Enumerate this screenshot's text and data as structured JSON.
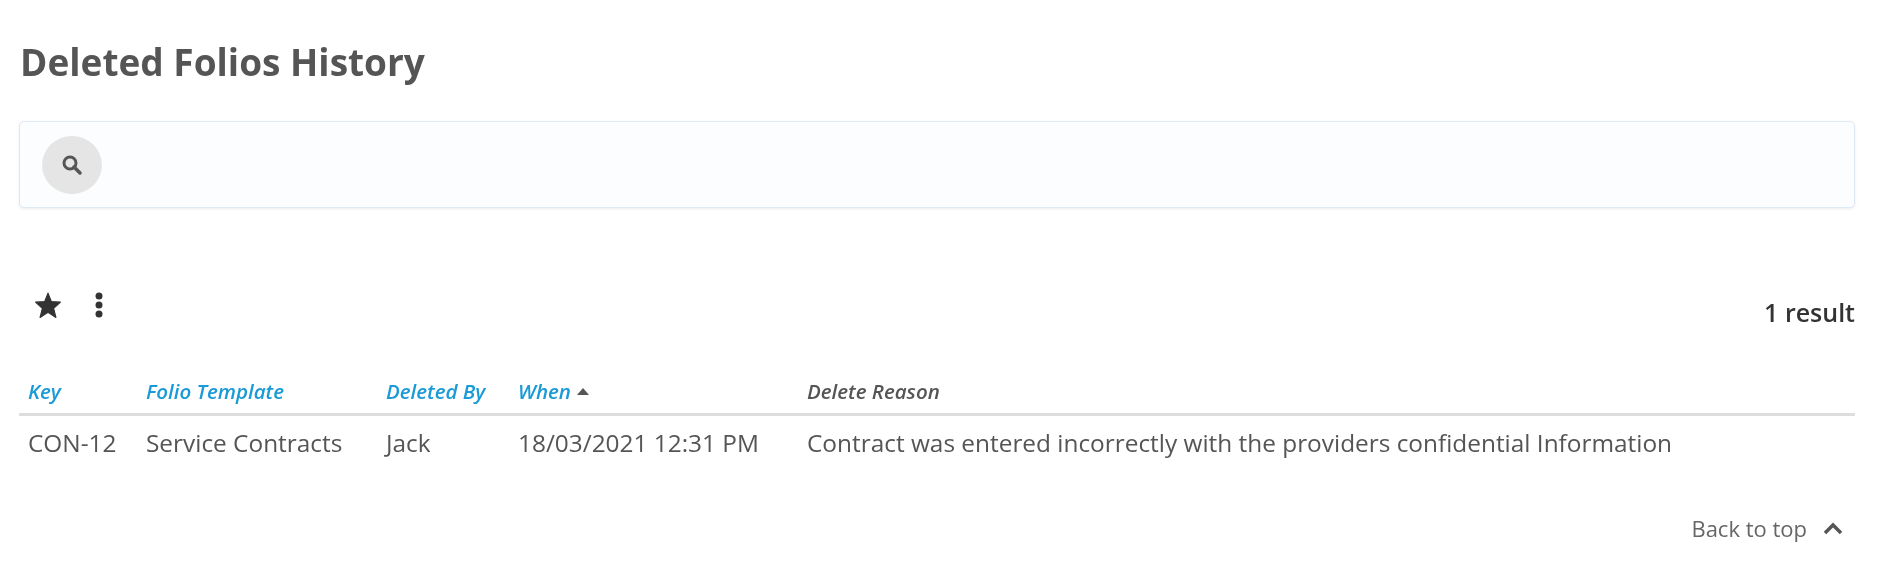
{
  "page": {
    "title": "Deleted Folios History"
  },
  "toolbar": {
    "result_count": "1 result"
  },
  "table": {
    "columns": [
      {
        "label": "Key",
        "sortable": true
      },
      {
        "label": "Folio Template",
        "sortable": true
      },
      {
        "label": "Deleted By",
        "sortable": true
      },
      {
        "label": "When",
        "sortable": true,
        "sorted": true
      },
      {
        "label": "Delete Reason",
        "sortable": false
      }
    ],
    "rows": [
      {
        "cells": [
          "CON-12",
          "Service Contracts",
          "Jack",
          "18/03/2021 12:31 PM",
          "Contract was entered incorrectly with the providers confidential Information"
        ]
      }
    ]
  },
  "footer": {
    "back_to_top": "Back to top"
  }
}
